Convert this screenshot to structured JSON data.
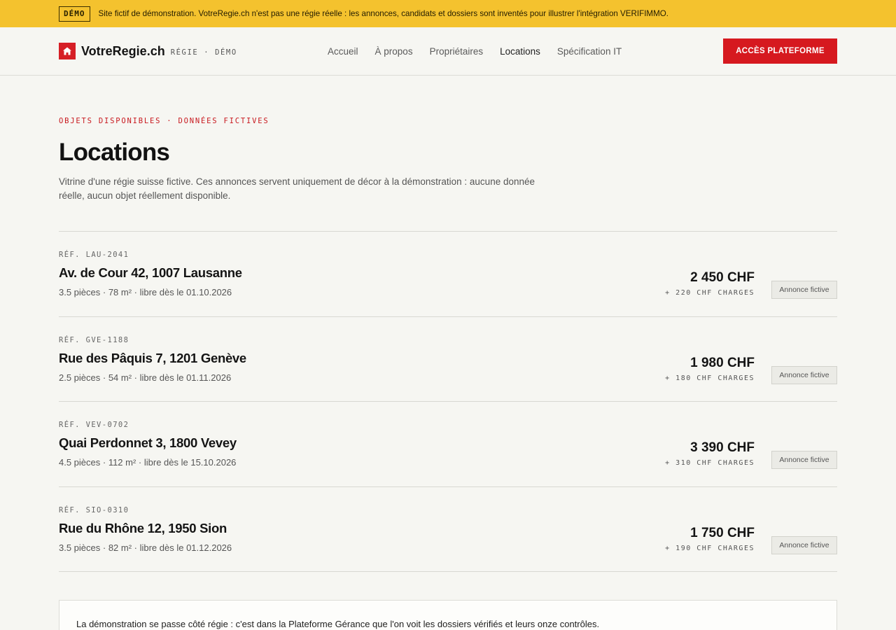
{
  "banner": {
    "badge": "DÉMO",
    "text": "Site fictif de démonstration. VotreRegie.ch n'est pas une régie réelle : les annonces, candidats et dossiers sont inventés pour illustrer l'intégration VERIFIMMO."
  },
  "header": {
    "logo_icon": "house-icon",
    "brand_name": "VotreRegie.ch",
    "brand_sub": "RÉGIE · DÉMO",
    "nav": [
      {
        "label": "Accueil",
        "active": false
      },
      {
        "label": "À propos",
        "active": false
      },
      {
        "label": "Propriétaires",
        "active": false
      },
      {
        "label": "Locations",
        "active": true
      },
      {
        "label": "Spécification IT",
        "active": false
      }
    ],
    "cta_label": "ACCÈS PLATEFORME"
  },
  "colors": {
    "banner": "#f4c22e",
    "accent": "#d6191f",
    "background": "#f6f6f2"
  },
  "main": {
    "eyebrow": "OBJETS DISPONIBLES · DONNÉES FICTIVES",
    "title": "Locations",
    "intro": "Vitrine d'une régie suisse fictive. Ces annonces servent uniquement de décor à la démonstration : aucune donnée réelle, aucun objet réellement disponible.",
    "listings": [
      {
        "ref": "RÉF. LAU-2041",
        "address": "Av. de Cour 42, 1007 Lausanne",
        "details": "3.5 pièces · 78 m² · libre dès le 01.10.2026",
        "price": "2 450 CHF",
        "charges": "+ 220 CHF CHARGES",
        "tag": "Annonce fictive"
      },
      {
        "ref": "RÉF. GVE-1188",
        "address": "Rue des Pâquis 7, 1201 Genève",
        "details": "2.5 pièces · 54 m² · libre dès le 01.11.2026",
        "price": "1 980 CHF",
        "charges": "+ 180 CHF CHARGES",
        "tag": "Annonce fictive"
      },
      {
        "ref": "RÉF. VEV-0702",
        "address": "Quai Perdonnet 3, 1800 Vevey",
        "details": "4.5 pièces · 112 m² · libre dès le 15.10.2026",
        "price": "3 390 CHF",
        "charges": "+ 310 CHF CHARGES",
        "tag": "Annonce fictive"
      },
      {
        "ref": "RÉF. SIO-0310",
        "address": "Rue du Rhône 12, 1950 Sion",
        "details": "3.5 pièces · 82 m² · libre dès le 01.12.2026",
        "price": "1 750 CHF",
        "charges": "+ 190 CHF CHARGES",
        "tag": "Annonce fictive"
      }
    ],
    "note": "La démonstration se passe côté régie : c'est dans la Plateforme Gérance que l'on voit les dossiers vérifiés et leurs onze contrôles."
  }
}
